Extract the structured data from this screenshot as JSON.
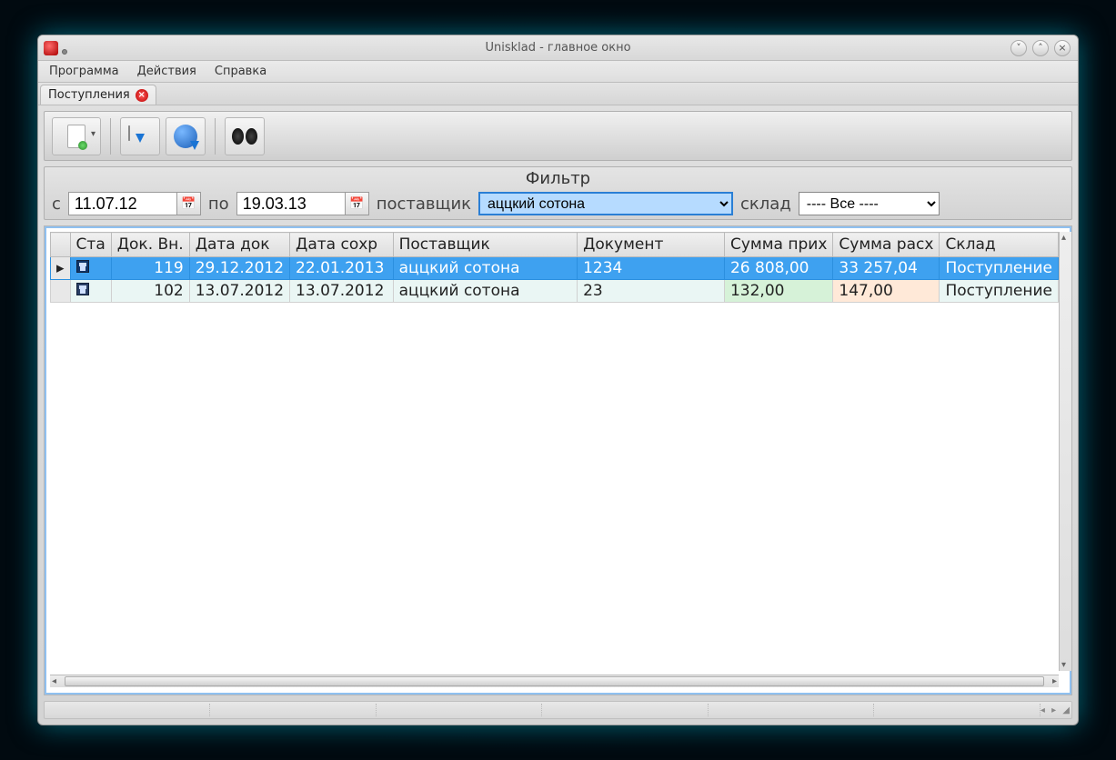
{
  "window": {
    "title": "Unisklad - главное окно"
  },
  "menubar": {
    "items": [
      "Программа",
      "Действия",
      "Справка"
    ]
  },
  "tabs": [
    {
      "label": "Поступления"
    }
  ],
  "toolbar": {
    "buttons": [
      "new-document",
      "db-download",
      "web-download",
      "search"
    ]
  },
  "filter": {
    "title": "Фильтр",
    "from_label": "с",
    "from_value": "11.07.12",
    "to_label": "по",
    "to_value": "19.03.13",
    "supplier_label": "поставщик",
    "supplier_value": "аццкий сотона",
    "supplier_options": [
      "аццкий сотона"
    ],
    "warehouse_label": "склад",
    "warehouse_value": "---- Все ----",
    "warehouse_options": [
      "---- Все ----"
    ]
  },
  "grid": {
    "columns": [
      "",
      "Ста",
      "Док. Вн.",
      "Дата док",
      "Дата сохр",
      "Поставщик",
      "Документ",
      "Сумма прих",
      "Сумма расх",
      "Склад"
    ],
    "rows": [
      {
        "selected": true,
        "marker": "▸",
        "status_icon": "save",
        "doc_no": "119",
        "doc_date": "29.12.2012",
        "save_date": "22.01.2013",
        "supplier": "аццкий сотона",
        "document": "1234",
        "sum_in": "26 808,00",
        "sum_out": "33 257,04",
        "warehouse": "Поступление"
      },
      {
        "selected": false,
        "marker": "",
        "status_icon": "save",
        "doc_no": "102",
        "doc_date": "13.07.2012",
        "save_date": "13.07.2012",
        "supplier": "аццкий сотона",
        "document": "23",
        "sum_in": "132,00",
        "sum_out": "147,00",
        "warehouse": "Поступление"
      }
    ]
  }
}
